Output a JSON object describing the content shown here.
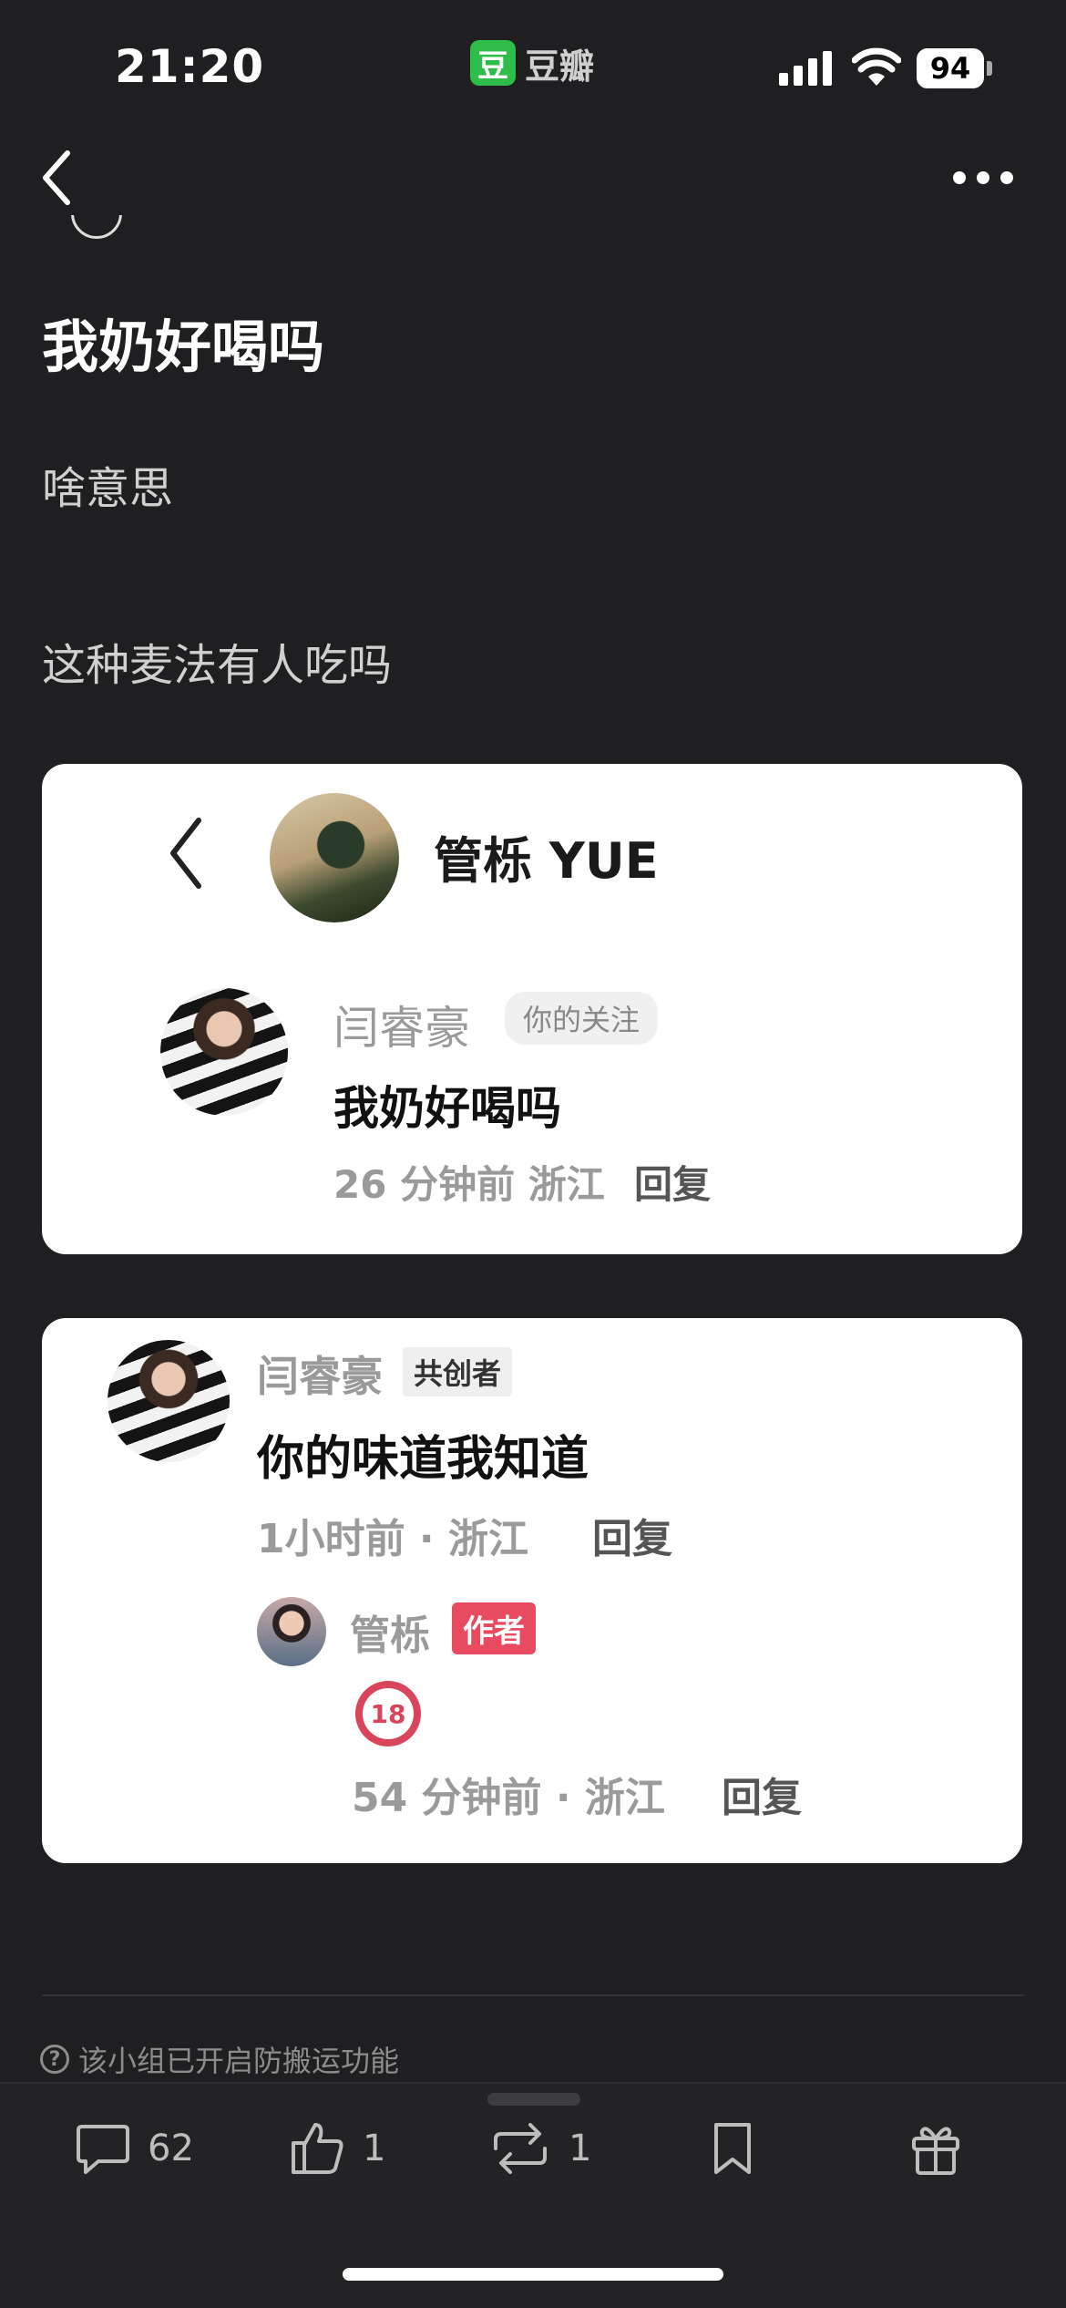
{
  "status_bar": {
    "time": "21:20",
    "app_logo": "豆",
    "app_name": "豆瓣",
    "battery": "94"
  },
  "post": {
    "title": "我奶好喝吗",
    "paragraphs": [
      "啥意思",
      "这种麦法有人吃吗"
    ]
  },
  "card1": {
    "header_name": "管栎 YUE",
    "comment": {
      "user": "闫睿豪",
      "tag": "你的关注",
      "text": "我奶好喝吗",
      "meta": "26 分钟前 浙江",
      "reply": "回复"
    }
  },
  "card2": {
    "comment": {
      "user": "闫睿豪",
      "tag": "共创者",
      "text": "你的味道我知道",
      "meta": "1小时前 · 浙江",
      "reply": "回复"
    },
    "subreply": {
      "user": "管栎",
      "tag": "作者",
      "emoji": "18",
      "meta": "54 分钟前 · 浙江",
      "reply": "回复"
    }
  },
  "footer": {
    "notice": "该小组已开启防搬运功能",
    "actions": {
      "comments": "62",
      "likes": "1",
      "reshares": "1"
    }
  },
  "icons": [
    "back-icon",
    "more-icon",
    "comment-icon",
    "like-icon",
    "reshare-icon",
    "bookmark-icon",
    "gift-icon",
    "help-icon"
  ]
}
